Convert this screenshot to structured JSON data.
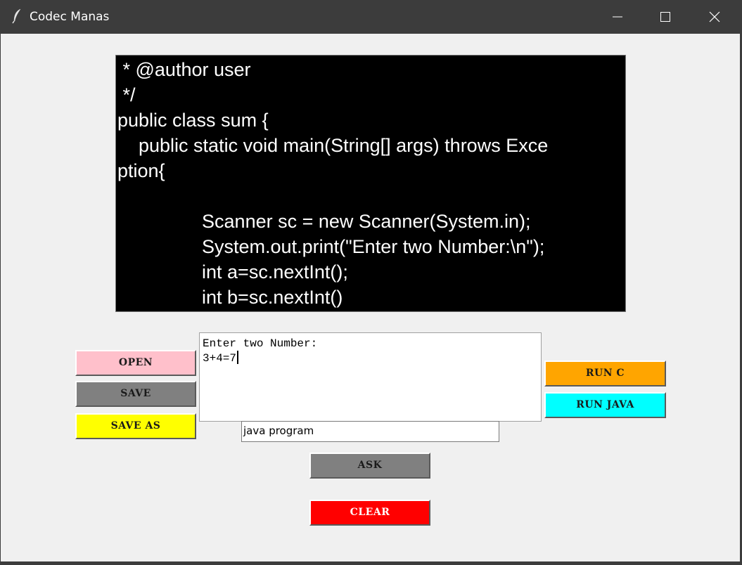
{
  "window": {
    "title": "Codec Manas",
    "icon": "feather-icon"
  },
  "editor": {
    "lines": [
      " * @author user",
      " */",
      "public class sum {",
      "    public static void main(String[] args) throws Exce",
      "ption{",
      "",
      "                Scanner sc = new Scanner(System.in);",
      "                System.out.print(\"Enter two Number:\\n\");",
      "                int a=sc.nextInt();",
      "                int b=sc.nextInt()"
    ]
  },
  "output": {
    "lines": [
      "Enter two Number:",
      "3+4=7"
    ]
  },
  "entry": {
    "value": "java program"
  },
  "buttons": {
    "open": "OPEN",
    "save": "SAVE",
    "save_as": "SAVE AS",
    "run_c": "RUN C",
    "run_java": "RUN JAVA",
    "ask": "ASK",
    "clear": "CLEAR"
  },
  "colors": {
    "open": "#ffc0cb",
    "save": "#808080",
    "save_as": "#ffff00",
    "run_c": "#ffa500",
    "run_java": "#00ffff",
    "ask": "#808080",
    "clear": "#ff0000",
    "editor_bg": "#000000",
    "editor_fg": "#ffffff"
  }
}
